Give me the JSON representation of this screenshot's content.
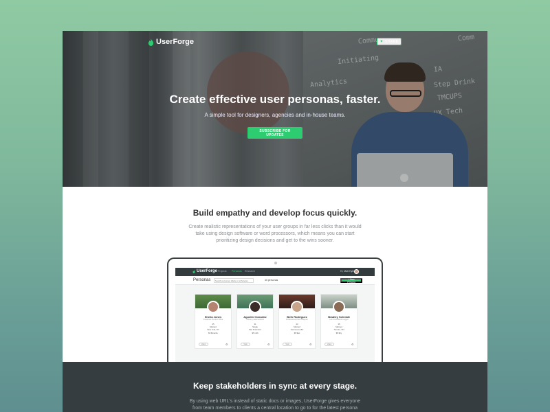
{
  "brand": {
    "name": "UserForge"
  },
  "hero": {
    "share_label": "SHARE",
    "headline": "Create effective user personas, faster.",
    "subheadline": "A simple tool for designers, agencies and in-house teams.",
    "cta_label": "SUBSCRIBE FOR UPDATES",
    "whiteboard_lines": [
      "Commu",
      "Initiating",
      "Analytics",
      "Step Drink",
      "TMCUPS",
      "IA",
      "UX Tech",
      "Comm"
    ]
  },
  "section_empathy": {
    "title": "Build empathy and develop focus quickly.",
    "body": "Create realistic representations of your user groups in far less clicks than it would take using design software or word processors, which means you can start prioritizing design decisions and get to the wins sooner."
  },
  "app": {
    "logo": "UserForge",
    "nav": [
      "Projects",
      "Personas",
      "Research"
    ],
    "active_nav": "Personas",
    "account": "Hi, Matt Hybig",
    "page_title": "Personas",
    "search_placeholder": "Search personas, labels or archetypes",
    "count_label": "40 personas",
    "new_button": "+ New Persona",
    "cards": [
      {
        "name": "Sheila Jones",
        "role": "Freelance Product Office",
        "age": "45",
        "status": "Married",
        "location": "New York, NY",
        "income": "$5 $/cache",
        "action": "Listen"
      },
      {
        "name": "Agustin Gonzalez",
        "role": "Offering Jacknessfield",
        "age": "31",
        "status": "Single",
        "location": "San Francisco",
        "income": "$5 mRt",
        "action": "View"
      },
      {
        "name": "Beth Rodriguez",
        "role": "Professional Plant Designer",
        "age": "23",
        "status": "Married",
        "location": "Vancouver, BC",
        "income": "$5 $tel",
        "action": "View"
      },
      {
        "name": "Bradley Schmidt",
        "role": "Lab Consultants Logger",
        "age": "35",
        "status": "Married",
        "location": "Toronto, ON",
        "income": "$5 $hy",
        "action": "Listen"
      }
    ]
  },
  "section_stakeholders": {
    "title": "Keep stakeholders in sync at every stage.",
    "body": "By using web URL's instead of static docs or images, UserForge gives everyone from team members to clients a central location to go to for the latest persona iteration. You"
  },
  "colors": {
    "accent": "#2ecc71",
    "dark": "#353d40",
    "text": "#333333"
  }
}
